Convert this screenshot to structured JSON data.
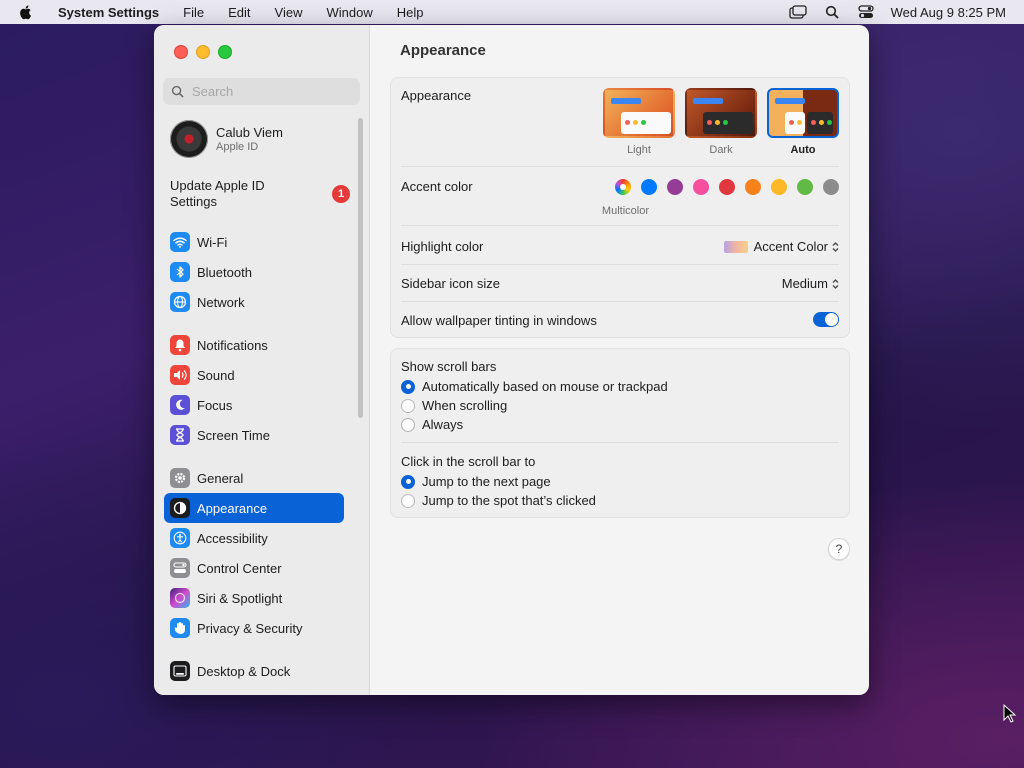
{
  "menubar": {
    "app_name": "System Settings",
    "menus": [
      "File",
      "Edit",
      "View",
      "Window",
      "Help"
    ],
    "clock": "Wed Aug 9  8:25 PM"
  },
  "sidebar": {
    "search_placeholder": "Search",
    "profile": {
      "name": "Calub Viem",
      "subtitle": "Apple ID"
    },
    "update": {
      "label": "Update Apple ID Settings",
      "badge": "1"
    },
    "group1": [
      {
        "label": "Wi-Fi",
        "icon": "wifi-icon",
        "color": "#1e8af4"
      },
      {
        "label": "Bluetooth",
        "icon": "bluetooth-icon",
        "color": "#1e8af4"
      },
      {
        "label": "Network",
        "icon": "globe-icon",
        "color": "#1e8af4"
      }
    ],
    "group2": [
      {
        "label": "Notifications",
        "icon": "bell-icon",
        "color": "#f0453a"
      },
      {
        "label": "Sound",
        "icon": "speaker-icon",
        "color": "#f0453a"
      },
      {
        "label": "Focus",
        "icon": "moon-icon",
        "color": "#5b50d6"
      },
      {
        "label": "Screen Time",
        "icon": "hourglass-icon",
        "color": "#5b50d6"
      }
    ],
    "group3": [
      {
        "label": "General",
        "icon": "gear-icon",
        "color": "#8e8e93"
      },
      {
        "label": "Appearance",
        "icon": "appearance-icon",
        "color": "#1d1d1f",
        "selected": true
      },
      {
        "label": "Accessibility",
        "icon": "accessibility-icon",
        "color": "#1e8af4"
      },
      {
        "label": "Control Center",
        "icon": "control-center-icon",
        "color": "#8e8e93"
      },
      {
        "label": "Siri & Spotlight",
        "icon": "siri-icon",
        "color": "#6b3fd6"
      },
      {
        "label": "Privacy & Security",
        "icon": "hand-icon",
        "color": "#1e8af4"
      }
    ],
    "group4": [
      {
        "label": "Desktop & Dock",
        "icon": "dock-icon",
        "color": "#1d1d1f"
      }
    ]
  },
  "main": {
    "title": "Appearance",
    "appearance": {
      "label": "Appearance",
      "options": [
        "Light",
        "Dark",
        "Auto"
      ],
      "selected": "Auto"
    },
    "accent": {
      "label": "Accent color",
      "multicolor_caption": "Multicolor",
      "colors": [
        "#007aff",
        "#953d96",
        "#f74f9e",
        "#e0383e",
        "#f7821b",
        "#fcb827",
        "#62ba46",
        "#8c8c8c"
      ]
    },
    "highlight": {
      "label": "Highlight color",
      "value": "Accent Color"
    },
    "sidebar_icon_size": {
      "label": "Sidebar icon size",
      "value": "Medium"
    },
    "wallpaper_tinting": {
      "label": "Allow wallpaper tinting in windows",
      "on": true
    },
    "scroll_bars": {
      "label": "Show scroll bars",
      "options": [
        {
          "label": "Automatically based on mouse or trackpad",
          "selected": true
        },
        {
          "label": "When scrolling",
          "selected": false
        },
        {
          "label": "Always",
          "selected": false
        }
      ]
    },
    "click_scroll": {
      "label": "Click in the scroll bar to",
      "options": [
        {
          "label": "Jump to the next page",
          "selected": true
        },
        {
          "label": "Jump to the spot that’s clicked",
          "selected": false
        }
      ]
    },
    "help": "?"
  }
}
